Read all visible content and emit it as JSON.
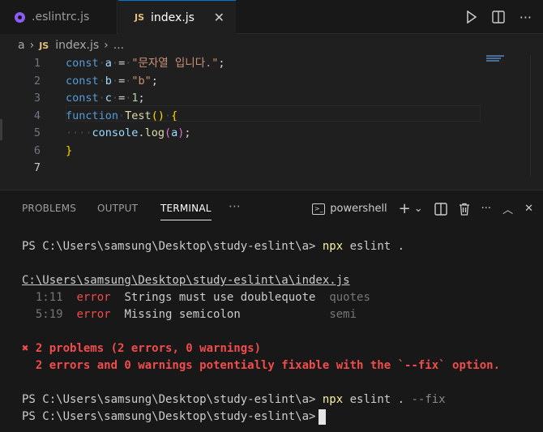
{
  "tabs": [
    {
      "label": ".eslintrc.js",
      "icon": "eslint-icon",
      "active": false
    },
    {
      "label": "index.js",
      "icon": "js-icon",
      "badge": "JS",
      "active": true
    }
  ],
  "tab_close": "✕",
  "breadcrumb": {
    "root": "a",
    "sep": "›",
    "badge": "JS",
    "file": "index.js",
    "more": "..."
  },
  "editor": {
    "line_numbers": [
      "1",
      "2",
      "3",
      "4",
      "5",
      "6",
      "7"
    ],
    "lines": [
      [
        {
          "t": "const",
          "c": "kw"
        },
        {
          "t": "·",
          "c": "dot"
        },
        {
          "t": "a",
          "c": "var"
        },
        {
          "t": "·",
          "c": "dot"
        },
        {
          "t": "=",
          "c": "op"
        },
        {
          "t": "·",
          "c": "dot"
        },
        {
          "t": "\"문자열 입니다.\"",
          "c": "str"
        },
        {
          "t": ";",
          "c": "op"
        }
      ],
      [
        {
          "t": "const",
          "c": "kw"
        },
        {
          "t": "·",
          "c": "dot"
        },
        {
          "t": "b",
          "c": "var"
        },
        {
          "t": "·",
          "c": "dot"
        },
        {
          "t": "=",
          "c": "op"
        },
        {
          "t": "·",
          "c": "dot"
        },
        {
          "t": "\"b\"",
          "c": "str"
        },
        {
          "t": ";",
          "c": "op"
        }
      ],
      [
        {
          "t": "const",
          "c": "kw"
        },
        {
          "t": "·",
          "c": "dot"
        },
        {
          "t": "c",
          "c": "var"
        },
        {
          "t": "·",
          "c": "dot"
        },
        {
          "t": "=",
          "c": "op"
        },
        {
          "t": "·",
          "c": "dot"
        },
        {
          "t": "1",
          "c": "num"
        },
        {
          "t": ";",
          "c": "op"
        }
      ],
      [
        {
          "t": "function",
          "c": "kw"
        },
        {
          "t": "·",
          "c": "dot"
        },
        {
          "t": "Test",
          "c": "fn"
        },
        {
          "t": "()",
          "c": "brace"
        },
        {
          "t": "·",
          "c": "dot"
        },
        {
          "t": "{",
          "c": "brace"
        }
      ],
      [
        {
          "t": "····",
          "c": "dot"
        },
        {
          "t": "console",
          "c": "var"
        },
        {
          "t": ".",
          "c": "op"
        },
        {
          "t": "log",
          "c": "fn"
        },
        {
          "t": "(",
          "c": "paren"
        },
        {
          "t": "a",
          "c": "var"
        },
        {
          "t": ")",
          "c": "paren"
        },
        {
          "t": ";",
          "c": "op"
        }
      ],
      [
        {
          "t": "}",
          "c": "brace"
        }
      ],
      []
    ],
    "active_line": 7
  },
  "panel": {
    "tabs": [
      "PROBLEMS",
      "OUTPUT",
      "TERMINAL"
    ],
    "active_tab": "TERMINAL",
    "more": "···",
    "shell": "powershell"
  },
  "terminal": {
    "prompt1": "PS C:\\Users\\samsung\\Desktop\\study-eslint\\a> ",
    "cmd1": "npx",
    "args1": " eslint .",
    "file_path": "C:\\Users\\samsung\\Desktop\\study-eslint\\a\\index.js",
    "problems": [
      {
        "loc": "1:11",
        "level": "error",
        "msg": "Strings must use doublequote",
        "rule": "quotes"
      },
      {
        "loc": "5:19",
        "level": "error",
        "msg": "Missing semicolon",
        "rule": "semi"
      }
    ],
    "summary_icon": "✖",
    "summary": " 2 problems (2 errors, 0 warnings)",
    "fixable": "  2 errors and 0 warnings potentially fixable with the `--fix` option.",
    "prompt2": "PS C:\\Users\\samsung\\Desktop\\study-eslint\\a> ",
    "cmd2": "npx",
    "args2": " eslint . ",
    "flag2": "--fix",
    "prompt3": "PS C:\\Users\\samsung\\Desktop\\study-eslint\\a>"
  }
}
